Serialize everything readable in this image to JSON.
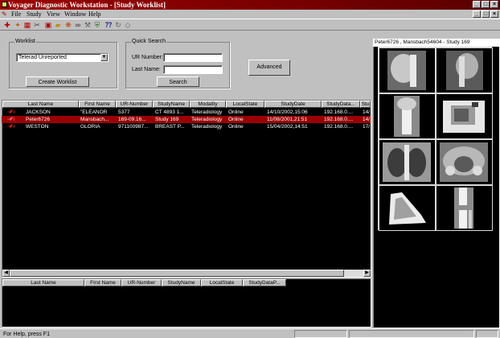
{
  "app": {
    "title": "Voyager Diagnostic Workstation - [Study Worklist]"
  },
  "menu": [
    "File",
    "Study",
    "View",
    "Window",
    "Help"
  ],
  "window_buttons": {
    "minimize": "_",
    "maximize": "□",
    "close": "×"
  },
  "toolbar_icons": [
    "stethoscope-icon",
    "wand-icon",
    "grid-icon",
    "cut-icon",
    "calendar-icon",
    "folder-open-icon",
    "network-icon",
    "binoculars-icon",
    "tools-icon",
    "shield-icon",
    "help-pointer-icon",
    "refresh-icon",
    "eraser-icon"
  ],
  "worklist": {
    "group_label": "Worklist",
    "selected": "Telerad Unreported",
    "create_button": "Create Worklist"
  },
  "quick_search": {
    "group_label": "Quick Search",
    "ur_label": "UR Number:",
    "ur_value": "",
    "lastname_label": "Last Name:",
    "lastname_value": "",
    "search_button": "Search",
    "advanced_button": "Advanced"
  },
  "studies": {
    "columns": [
      "Last Name",
      "First Name",
      "UR-Number",
      "StudyName",
      "Modality",
      "LocalState",
      "StudyDate",
      "StudyData...",
      "Stu"
    ],
    "rows": [
      {
        "last": "JACKSON",
        "first": "\"ELEANOR",
        "ur": "5377",
        "study": "CT 4893 1...",
        "modality": "Teleradiology",
        "state": "Online",
        "date": "14/10/2002,15:06",
        "data": "192.168.0....",
        "stu": "14/",
        "selected": false
      },
      {
        "last": "Peter6726",
        "first": "Mansbach...",
        "ur": "169-09.16...",
        "study": "Study 169",
        "modality": "Teleradiology",
        "state": "Online",
        "date": "11/08/2001,21:51",
        "data": "192.168.0....",
        "stu": "14/",
        "selected": true
      },
      {
        "last": "WESTON",
        "first": "GLORIA",
        "ur": "971100987...",
        "study": "BREAST P...",
        "modality": "Teleradiology",
        "state": "Online",
        "date": "15/04/2002,14:51",
        "data": "192.168.0....",
        "stu": "17/",
        "selected": false
      }
    ]
  },
  "bottom_table": {
    "columns": [
      "Last Name",
      "First Name",
      "UR-Number",
      "StudyName",
      "LocalState",
      "StudyDataP..."
    ]
  },
  "thumbnails": {
    "header": "Peter6726 , Mansbach54604 - Study 169",
    "images": [
      "cervical-spine-lateral",
      "cervical-spine-oblique",
      "cervical-spine-ap",
      "hand-pa",
      "chest-pa",
      "pelvis-ap",
      "foot-lateral",
      "knee-ap"
    ]
  },
  "status": {
    "text": "For Help, press F1"
  }
}
